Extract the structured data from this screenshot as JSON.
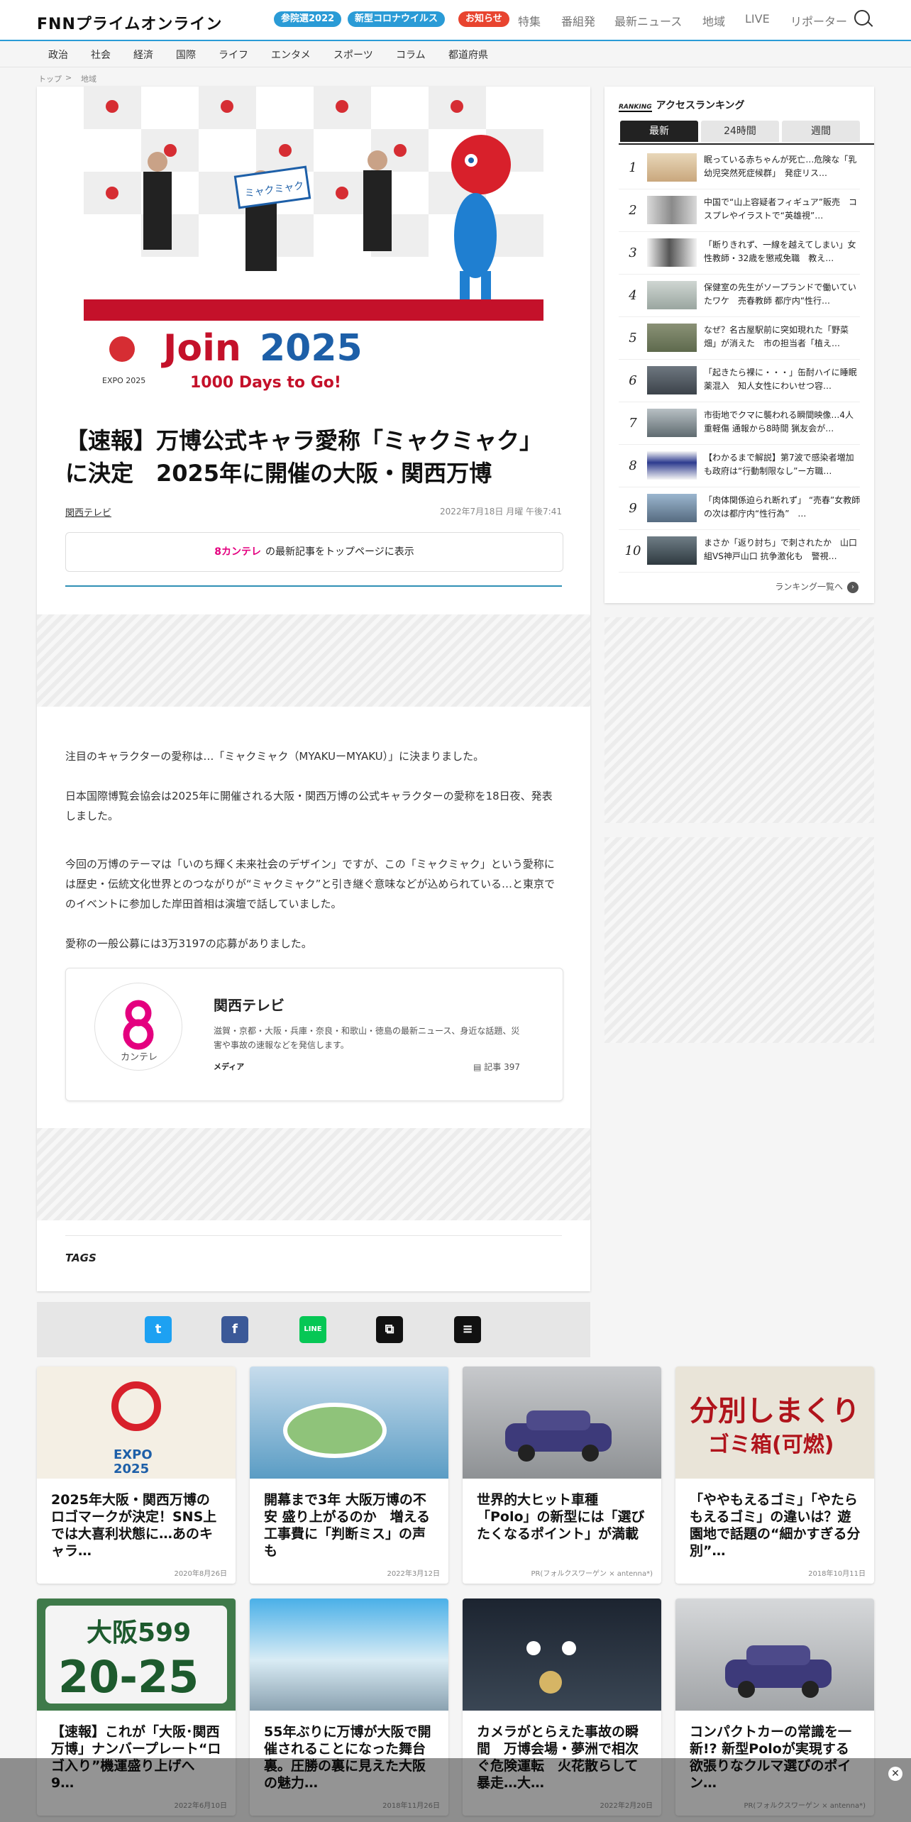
{
  "header": {
    "logo": "FNNプライムオンライン",
    "pills": [
      {
        "label": "参院選2022",
        "color": "#2a9bd6"
      },
      {
        "label": "新型コロナウイルス",
        "color": "#2a9bd6"
      },
      {
        "label": "お知らせ",
        "color": "#e8442f"
      }
    ],
    "nav": [
      "特集",
      "番組発",
      "最新ニュース",
      "地域",
      "LIVE",
      "リポーター"
    ]
  },
  "categories": [
    "政治",
    "社会",
    "経済",
    "国際",
    "ライフ",
    "エンタメ",
    "スポーツ",
    "コラム",
    "都道府県"
  ],
  "breadcrumb": {
    "home": "トップ",
    "sep": ">",
    "current": "地域"
  },
  "article": {
    "image_texts": {
      "mascot_sign": "ミャクミャク",
      "banner_join": "Join",
      "banner_year": "2025",
      "banner_sub": "1000 Days to Go!",
      "expo": "EXPO 2025"
    },
    "headline": "【速報】万博公式キャラ愛称「ミャクミャク」に決定　2025年に開催の大阪・関西万博",
    "source": "関西テレビ",
    "date": "2022年7月18日 月曜 午後7:41",
    "top_button": {
      "logo": "8カンテレ",
      "label": "の最新記事をトップページに表示"
    },
    "paragraphs": [
      "注目のキャラクターの愛称は…「ミャクミャク（MYAKUーMYAKU）」に決まりました。",
      "日本国際博覧会協会は2025年に開催される大阪・関西万博の公式キャラクターの愛称を18日夜、発表しました。",
      "今回の万博のテーマは「いのち輝く未来社会のデザイン」ですが、この「ミャクミャク」という愛称には歴史・伝統文化世界とのつながりが“ミャクミャク”と引き継ぐ意味などが込められている…と東京でのイベントに参加した岸田首相は演壇で話していました。",
      "愛称の一般公募には3万3197の応募がありました。"
    ],
    "author": {
      "logo_text": "カンテレ",
      "name": "関西テレビ",
      "description": "滋賀・京都・大阪・兵庫・奈良・和歌山・徳島の最新ニュース、身近な話題、災害や事故の速報などを発信します。",
      "type": "メディア",
      "count_label": "記事",
      "count": "397"
    },
    "tags_label": "TAGS"
  },
  "share": {
    "buttons": [
      {
        "name": "twitter",
        "glyph": "t",
        "color": "#1da1f2"
      },
      {
        "name": "facebook",
        "glyph": "f",
        "color": "#3b5998"
      },
      {
        "name": "line",
        "glyph": "LINE",
        "color": "#06c755"
      },
      {
        "name": "copy-link",
        "glyph": "⧉",
        "color": "#111"
      },
      {
        "name": "comment",
        "glyph": "≡",
        "color": "#111"
      }
    ]
  },
  "ranking": {
    "badge": "RANKING",
    "title": "アクセスランキング",
    "tabs": [
      "最新",
      "24時間",
      "週間"
    ],
    "items": [
      {
        "rank": "1",
        "text": "眠っている赤ちゃんが死亡…危険な「乳幼児突然死症候群」　発症リス…"
      },
      {
        "rank": "2",
        "text": "中国で“山上容疑者フィギュア”販売　コスプレやイラストで“英雄視”…"
      },
      {
        "rank": "3",
        "text": "「断りきれず、一線を越えてしまい」女性教師・32歳を懲戒免職　教え…"
      },
      {
        "rank": "4",
        "text": "保健室の先生がソープランドで働いていたワケ　売春教師 都庁内“性行…"
      },
      {
        "rank": "5",
        "text": "なぜ？名古屋駅前に突如現れた「野菜畑」が消えた　市の担当者「植え…"
      },
      {
        "rank": "6",
        "text": "「起きたら裸に・・・」缶酎ハイに睡眠薬混入　知人女性にわいせつ容…"
      },
      {
        "rank": "7",
        "text": "市街地でクマに襲われる瞬間映像…4人重軽傷 通報から8時間 猟友会が…"
      },
      {
        "rank": "8",
        "text": "【わかるまで解説】第7波で感染者増加も政府は“行動制限なし”ー方職…"
      },
      {
        "rank": "9",
        "text": "「肉体関係迫られ断れず」 “売春”女教師の次は都庁内“性行為”　…"
      },
      {
        "rank": "10",
        "text": "まさか「返り討ち」で刺されたか　山口組VS神戸山口 抗争激化も　警視…"
      }
    ],
    "more": "ランキング一覧へ"
  },
  "recommendations": [
    {
      "title": "2025年大阪・関西万博のロゴマークが決定！SNS上では大喜利状態に…あのキャラ…",
      "meta": "2020年8月26日",
      "thumb_text": "EXPO\n2025"
    },
    {
      "title": "開幕まで3年 大阪万博の不安 盛り上がるのか　増える工事費に「判断ミス」の声も",
      "meta": "2022年3月12日",
      "thumb_text": ""
    },
    {
      "title": "世界的大ヒット車種「Polo」の新型には「選びたくなるポイント」が満載",
      "meta": "PR(フォルクスワーゲン × antenna*)",
      "thumb_text": ""
    },
    {
      "title": "「ややもえるゴミ」「やたらもえるゴミ」の違いは？遊園地で話題の“細かすぎる分別”…",
      "meta": "2018年10月11日",
      "thumb_text": "分別しまくり\nゴミ箱(可燃)"
    },
    {
      "title": "【速報】これが「大阪･関西万博」ナンバープレート“ロゴ入り”機運盛り上げへ　9…",
      "meta": "2022年6月10日",
      "thumb_text": "大阪599\nさ 20-25"
    },
    {
      "title": "55年ぶりに万博が大阪で開催されることになった舞台裏。圧勝の裏に見えた大阪の魅力…",
      "meta": "2018年11月26日",
      "thumb_text": ""
    },
    {
      "title": "カメラがとらえた事故の瞬間　万博会場・夢洲で相次ぐ危険運転　火花散らして暴走…大…",
      "meta": "2022年2月20日",
      "thumb_text": ""
    },
    {
      "title": "コンパクトカーの常識を一新!? 新型Poloが実現する欲張りなクルマ選びのポイン…",
      "meta": "PR(フォルクスワーゲン × antenna*)",
      "thumb_text": ""
    }
  ]
}
